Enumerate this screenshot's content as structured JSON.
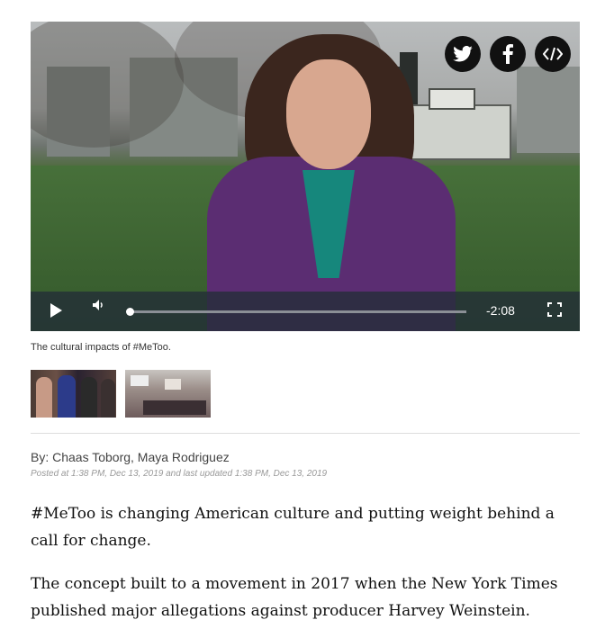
{
  "video": {
    "time_remaining": "-2:08",
    "progress": 0.0,
    "share_buttons": [
      {
        "icon": "twitter-icon"
      },
      {
        "icon": "facebook-icon"
      },
      {
        "icon": "embed-code-icon"
      }
    ]
  },
  "caption": "The cultural impacts of #MeToo.",
  "article": {
    "byline": "By: Chaas Toborg, Maya Rodriguez",
    "posted": "Posted at 1:38 PM, Dec 13, 2019 and last updated 1:38 PM, Dec 13, 2019",
    "paragraphs": [
      "#MeToo is changing American culture and putting weight behind a call for change.",
      "The concept built to a movement in 2017 when the New York Times published major allegations against producer Harvey Weinstein."
    ]
  },
  "colors": {
    "controls_bar": "#232d37",
    "coat": "#5b2d72",
    "turtleneck": "#16877c"
  }
}
